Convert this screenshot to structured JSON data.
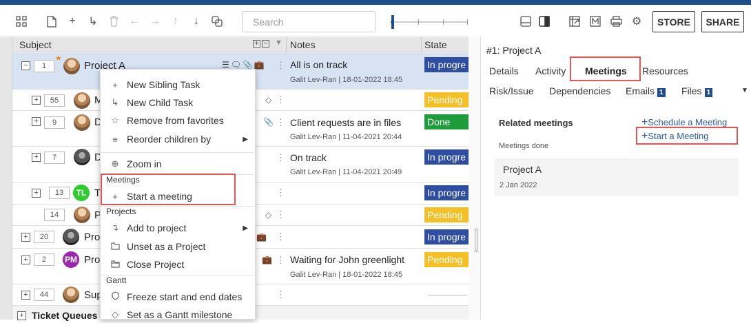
{
  "toolbar": {
    "search_placeholder": "Search",
    "store_label": "STORE",
    "share_label": "SHARE",
    "icons": [
      "grid-icon",
      "new-doc-icon",
      "add-icon",
      "indent-icon",
      "delete-icon",
      "back-icon",
      "forward-icon",
      "up-icon",
      "down-icon",
      "copy-icon",
      "layout-rows-icon",
      "layout-split-icon",
      "export-icon",
      "markdown-icon",
      "print-icon",
      "settings-icon"
    ]
  },
  "grid": {
    "columns": {
      "subject": "Subject",
      "notes": "Notes",
      "state": "State"
    },
    "rows": [
      {
        "id": "1",
        "subject": "Project A",
        "note": "All is on track",
        "meta": "Galit Lev-Ran | 18-01-2022 18:45",
        "state": "In progre",
        "state_color": "#2e4ea3"
      },
      {
        "id": "55",
        "subject": "M",
        "note": "",
        "meta": "",
        "state": "Pending",
        "state_color": "#f4c025"
      },
      {
        "id": "9",
        "subject": "D",
        "note": "Client requests are in files",
        "meta": "Galit Lev-Ran | 11-04-2021 20:44",
        "state": "Done",
        "state_color": "#1e9c3b"
      },
      {
        "id": "7",
        "subject": "D",
        "note": "On track",
        "meta": "Galit Lev-Ran | 11-04-2021 20:49",
        "state": "In progre",
        "state_color": "#2e4ea3"
      },
      {
        "id": "13",
        "subject": "T",
        "avatar_initials": "TL",
        "note": "",
        "meta": "",
        "state": "In progre",
        "state_color": "#2e4ea3"
      },
      {
        "id": "14",
        "subject": "P",
        "note": "",
        "meta": "",
        "state": "Pending",
        "state_color": "#f4c025"
      },
      {
        "id": "20",
        "subject": "Pro",
        "note": "",
        "meta": "",
        "state": "In progre",
        "state_color": "#2e4ea3"
      },
      {
        "id": "2",
        "subject": "Pro",
        "avatar_initials": "PM",
        "note": "Waiting for John greenlight",
        "meta": "Galit Lev-Ran | 18-01-2022 18:45",
        "state": "Pending",
        "state_color": "#f4c025"
      },
      {
        "id": "44",
        "subject": "Sup",
        "note": "",
        "meta": "",
        "state": "",
        "state_color": ""
      }
    ],
    "footer_group": "Ticket Queues"
  },
  "context_menu": {
    "items": [
      {
        "label": "New Sibling Task",
        "icon": "plus-icon"
      },
      {
        "label": "New Child Task",
        "icon": "child-arrow-icon"
      },
      {
        "label": "Remove from favorites",
        "icon": "star-icon"
      },
      {
        "label": "Reorder children by",
        "icon": "sort-icon",
        "has_submenu": true
      },
      {
        "label": "Zoom in",
        "icon": "zoom-in-icon"
      }
    ],
    "meetings_section": "Meetings",
    "start_meeting": "Start a meeting",
    "projects_section": "Projects",
    "project_items": [
      {
        "label": "Add to project",
        "icon": "corner-arrow-icon",
        "has_submenu": true
      },
      {
        "label": "Unset as a Project",
        "icon": "folder-icon"
      },
      {
        "label": "Close Project",
        "icon": "folder-closed-icon"
      }
    ],
    "gantt_section": "Gantt",
    "gantt_items": [
      {
        "label": "Freeze start and end dates",
        "icon": "shield-icon"
      },
      {
        "label": "Set as a Gantt milestone",
        "icon": "diamond-icon"
      }
    ]
  },
  "details_panel": {
    "title": "#1: Project A",
    "tabs_row1": [
      "Details",
      "Activity",
      "Meetings",
      "Resources"
    ],
    "tabs_row2": [
      {
        "label": "Risk/Issue"
      },
      {
        "label": "Dependencies"
      },
      {
        "label": "Emails",
        "count": "1"
      },
      {
        "label": "Files",
        "count": "1"
      }
    ],
    "active_tab": "Meetings",
    "related_meetings": "Related meetings",
    "schedule_link": "Schedule a Meeting",
    "start_link": "Start a Meeting",
    "meetings_done": "Meetings done",
    "meeting": {
      "title": "Project A",
      "date": "2 Jan 2022"
    }
  },
  "colors": {
    "accent": "#1f4e8c",
    "highlight": "#e05555",
    "selected_row": "#d7e3f3"
  }
}
